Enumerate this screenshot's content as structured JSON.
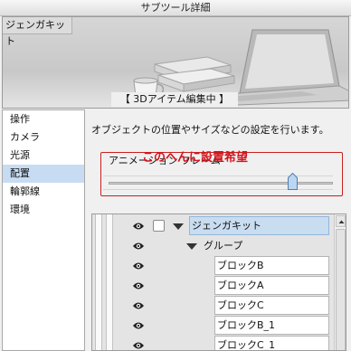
{
  "window": {
    "title": "サブツール詳細"
  },
  "preview": {
    "label": "ジェンガキット",
    "caption": "【 3Dアイテム編集中 】"
  },
  "sidebar": {
    "items": [
      {
        "label": "操作",
        "selected": false
      },
      {
        "label": "カメラ",
        "selected": false
      },
      {
        "label": "光源",
        "selected": false
      },
      {
        "label": "配置",
        "selected": true
      },
      {
        "label": "輪郭線",
        "selected": false
      },
      {
        "label": "環境",
        "selected": false
      }
    ]
  },
  "main": {
    "description": "オブジェクトの位置やサイズなどの設定を行います。",
    "animation": {
      "label": "アニメーション フレーム",
      "note": "このへんに設置希望",
      "slider_value": 0.82
    },
    "tree": {
      "rows": [
        {
          "label": "ジェンガキット",
          "selected": true
        },
        {
          "label": "グループ",
          "selected": false
        },
        {
          "label": "ブロックB",
          "selected": false
        },
        {
          "label": "ブロックA",
          "selected": false
        },
        {
          "label": "ブロックC",
          "selected": false
        },
        {
          "label": "ブロックB_1",
          "selected": false
        },
        {
          "label": "ブロックC_1",
          "selected": false
        }
      ]
    }
  },
  "colors": {
    "accent_red": "#d4141c",
    "selection_blue": "#c9ddf1"
  }
}
